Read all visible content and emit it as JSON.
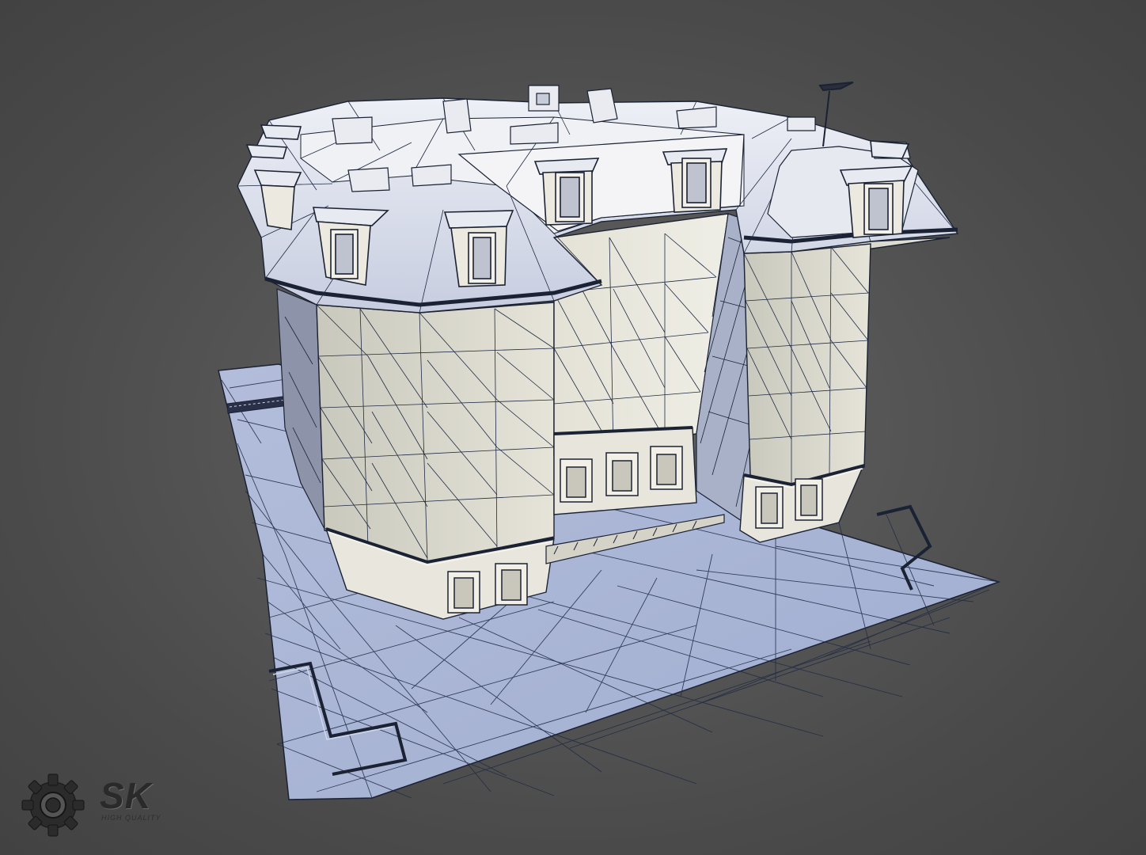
{
  "viewport": {
    "background_color": "#4d4d4d",
    "model_fill": "#eae8dc",
    "ground_fill": "#aab6d4",
    "wire_color": "#1a2233"
  },
  "logo": {
    "brand": "SK",
    "tagline": "HIGH QUALITY",
    "icon": "gear-icon"
  }
}
